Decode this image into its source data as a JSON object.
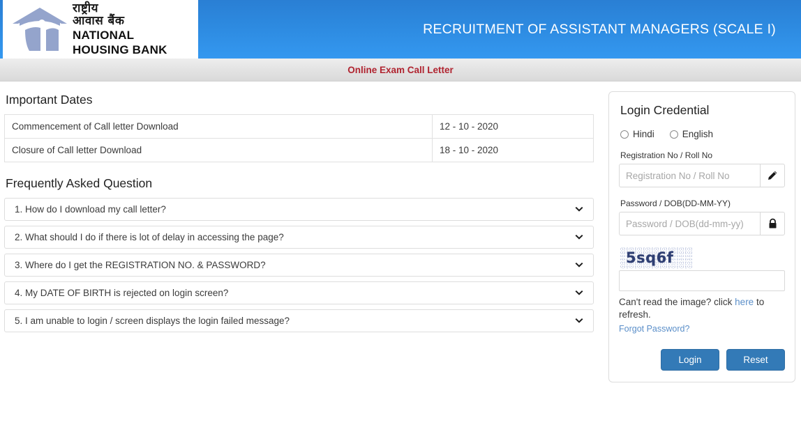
{
  "header": {
    "logo": {
      "hindi_line1": "राष्ट्रीय",
      "hindi_line2": "आवास बैंक",
      "english_line1": "NATIONAL",
      "english_line2": "HOUSING BANK"
    },
    "title": "RECRUITMENT OF ASSISTANT MANAGERS (SCALE I)",
    "accent_color": "#2d8ae0"
  },
  "subbar": {
    "text": "Online Exam Call Letter",
    "color": "#b02430"
  },
  "important_dates": {
    "heading": "Important Dates",
    "rows": [
      {
        "label": "Commencement of Call letter Download",
        "value": "12 - 10 - 2020"
      },
      {
        "label": "Closure of Call letter Download",
        "value": "18 - 10 - 2020"
      }
    ]
  },
  "faq": {
    "heading": "Frequently Asked Question",
    "items": [
      {
        "question": "1. How do I download my call letter?",
        "icon": "chevron-down-icon"
      },
      {
        "question": "2. What should I do if there is lot of delay in accessing the page?",
        "icon": "chevron-down-icon"
      },
      {
        "question": "3. Where do I get the REGISTRATION NO. & PASSWORD?",
        "icon": "chevron-down-icon"
      },
      {
        "question": "4. My DATE OF BIRTH is rejected on login screen?",
        "icon": "chevron-down-icon"
      },
      {
        "question": "5. I am unable to login / screen displays the login failed message?",
        "icon": "chevron-down-icon"
      }
    ]
  },
  "login": {
    "title": "Login Credential",
    "language_options": [
      {
        "label": "Hindi",
        "selected": false
      },
      {
        "label": "English",
        "selected": false
      }
    ],
    "registration": {
      "label": "Registration No / Roll No",
      "placeholder": "Registration No / Roll No",
      "value": "",
      "addon_icon": "pencil-icon"
    },
    "password": {
      "label": "Password / DOB(DD-MM-YY)",
      "placeholder": "Password / DOB(dd-mm-yy)",
      "value": "",
      "addon_icon": "lock-icon"
    },
    "captcha": {
      "image_text": "5sq6f",
      "input_value": "",
      "input_placeholder": "",
      "refresh_prefix": "Can't read the image? click ",
      "refresh_link": "here",
      "refresh_suffix": " to refresh."
    },
    "forgot_password": "Forgot Password?",
    "buttons": {
      "login": "Login",
      "reset": "Reset"
    },
    "button_color": "#337ab7",
    "link_color": "#5b8fc9"
  }
}
